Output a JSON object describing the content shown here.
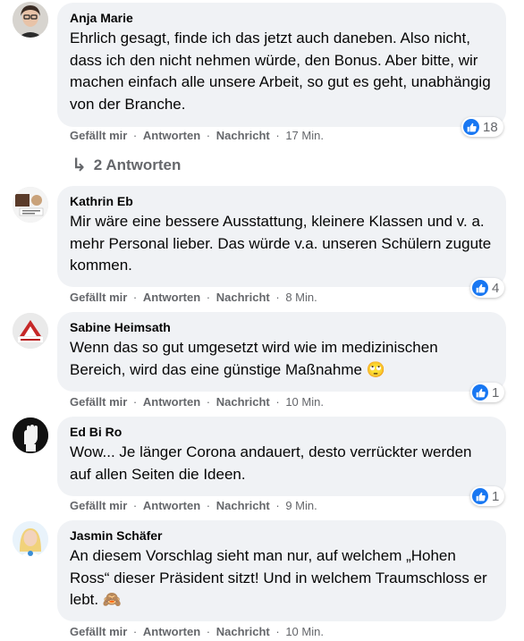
{
  "actions": {
    "like": "Gefällt mir",
    "reply": "Antworten",
    "message": "Nachricht",
    "separator": "·"
  },
  "comments": [
    {
      "author": "Anja Marie",
      "text": "Ehrlich gesagt, finde ich das jetzt auch daneben. Also nicht, dass ich den nicht nehmen würde, den Bonus. Aber bitte, wir machen einfach alle unsere Arbeit, so gut es geht, unabhängig von der Branche.",
      "time": "17 Min.",
      "likes": "18",
      "replies_label": "2 Antworten"
    },
    {
      "author": "Kathrin Eb",
      "text": "Mir wäre eine bessere Ausstattung, kleinere Klassen und v. a. mehr Personal lieber. Das würde v.a. unseren Schülern zugute kommen.",
      "time": "8 Min.",
      "likes": "4"
    },
    {
      "author": "Sabine Heimsath",
      "text": "Wenn das so gut umgesetzt wird wie im medizinischen Bereich, wird das eine günstige Maßnahme",
      "emoji": "🙄",
      "time": "10 Min.",
      "likes": "1"
    },
    {
      "author": "Ed Bi Ro",
      "text": "Wow... Je länger Corona andauert, desto verrückter werden auf allen Seiten die Ideen.",
      "time": "9 Min.",
      "likes": "1"
    },
    {
      "author": "Jasmin Schäfer",
      "text": "An diesem Vorschlag sieht man nur, auf welchem „Hohen Ross“ dieser Präsident sitzt! Und in welchem Traumschloss er lebt.",
      "emoji": "🙈",
      "time": "10 Min."
    }
  ]
}
